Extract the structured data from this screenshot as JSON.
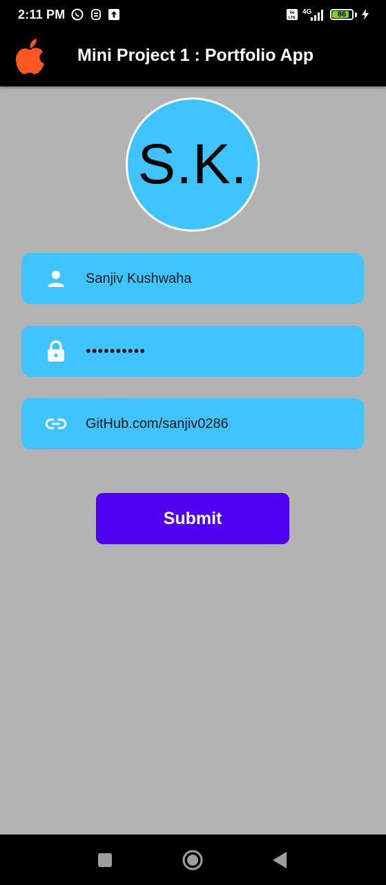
{
  "status_bar": {
    "time": "2:11 PM",
    "network": "4G",
    "battery": "86",
    "battery_level": 0.86,
    "icons": [
      "whatsapp-icon",
      "notification-icon",
      "upload-icon",
      "volte-icon",
      "signal-icon",
      "battery-icon",
      "charging-icon"
    ]
  },
  "app_bar": {
    "title": "Mini Project 1 : Portfolio App",
    "logo_icon": "apple-icon",
    "logo_color": "#ff5722"
  },
  "avatar": {
    "initials": "S.K.",
    "color": "#40c4ff"
  },
  "form": {
    "name": {
      "value": "Sanjiv Kushwaha",
      "icon": "person-icon"
    },
    "password": {
      "value": "••••••••••",
      "icon": "lock-icon"
    },
    "github": {
      "value": "GitHub.com/sanjiv0286",
      "icon": "link-icon"
    },
    "submit_label": "Submit",
    "field_color": "#40c4ff",
    "button_color": "#5000f0"
  },
  "nav_bar": {
    "buttons": [
      "recent-apps-icon",
      "home-icon",
      "back-icon"
    ]
  }
}
